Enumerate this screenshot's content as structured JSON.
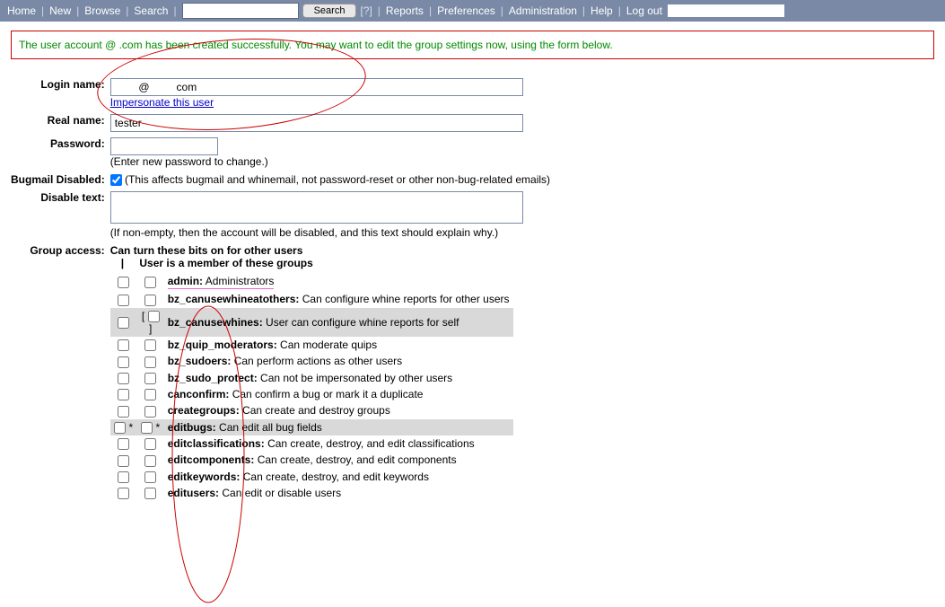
{
  "topbar": {
    "home": "Home",
    "new": "New",
    "browse": "Browse",
    "search_link": "Search",
    "search_btn": "Search",
    "help_q": "[?]",
    "reports": "Reports",
    "preferences": "Preferences",
    "administration": "Administration",
    "help": "Help",
    "logout": "Log out"
  },
  "message": {
    "prefix": "The user account ",
    "hidden_local": "        ",
    "at": "@",
    "hidden_domain": "        ",
    "suffix": ".com has been created successfully. You may want to edit the group settings now, using the form below."
  },
  "labels": {
    "login": "Login name:",
    "impersonate": "Impersonate this user",
    "realname": "Real name:",
    "password": "Password:",
    "pw_hint": "(Enter new password to change.)",
    "bugmail": "Bugmail Disabled:",
    "bugmail_hint": "(This affects bugmail and whinemail, not password-reset or other non-bug-related emails)",
    "disable": "Disable text:",
    "disable_hint": "(If non-empty, then the account will be disabled, and this text should explain why.)",
    "group_access": "Group access:",
    "can_turn_on": "Can turn these bits on for other users",
    "pipe": "|",
    "member_of": "User is a member of these groups"
  },
  "values": {
    "login": "        @         com",
    "realname": "tester",
    "bugmail_checked": true
  },
  "groups": [
    {
      "name": "admin",
      "desc": "Administrators",
      "shaded": false,
      "markA": "",
      "markB": "",
      "underline": true
    },
    {
      "name": "bz_canusewhineatothers",
      "desc": "Can configure whine reports for other users",
      "shaded": false,
      "markA": "",
      "markB": ""
    },
    {
      "name": "bz_canusewhines",
      "desc": "User can configure whine reports for self",
      "shaded": true,
      "markA": "",
      "markB": "",
      "bracketB": true
    },
    {
      "name": "bz_quip_moderators",
      "desc": "Can moderate quips",
      "shaded": false,
      "markA": "",
      "markB": ""
    },
    {
      "name": "bz_sudoers",
      "desc": "Can perform actions as other users",
      "shaded": false,
      "markA": "",
      "markB": ""
    },
    {
      "name": "bz_sudo_protect",
      "desc": "Can not be impersonated by other users",
      "shaded": false,
      "markA": "",
      "markB": ""
    },
    {
      "name": "canconfirm",
      "desc": "Can confirm a bug or mark it a duplicate",
      "shaded": false,
      "markA": "",
      "markB": ""
    },
    {
      "name": "creategroups",
      "desc": "Can create and destroy groups",
      "shaded": false,
      "markA": "",
      "markB": ""
    },
    {
      "name": "editbugs",
      "desc": "Can edit all bug fields",
      "shaded": true,
      "markA": "*",
      "markB": "*"
    },
    {
      "name": "editclassifications",
      "desc": "Can create, destroy, and edit classifications",
      "shaded": false,
      "markA": "",
      "markB": ""
    },
    {
      "name": "editcomponents",
      "desc": "Can create, destroy, and edit components",
      "shaded": false,
      "markA": "",
      "markB": ""
    },
    {
      "name": "editkeywords",
      "desc": "Can create, destroy, and edit keywords",
      "shaded": false,
      "markA": "",
      "markB": ""
    },
    {
      "name": "editusers",
      "desc": "Can edit or disable users",
      "shaded": false,
      "markA": "",
      "markB": ""
    }
  ]
}
